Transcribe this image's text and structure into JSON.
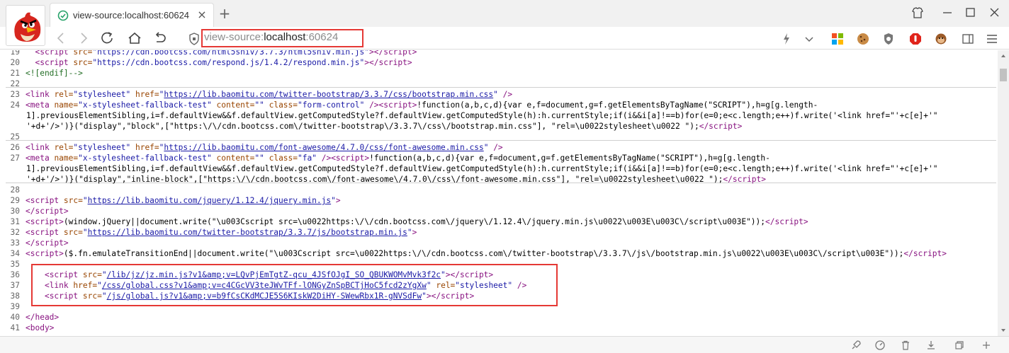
{
  "tab": {
    "title": "view-source:localhost:60624",
    "close": "×"
  },
  "new_tab": "+",
  "address": {
    "scheme": "view-source:",
    "host": "localhost",
    "port": ":60624"
  },
  "source_lines": [
    {
      "n": "19",
      "html": "  <span class=\"tag\">&lt;script</span> <span class=\"attr\">src=</span><span class=\"val\">\"https://cdn.bootcss.com/html5shiv/3.7.3/html5shiv.min.js\"</span><span class=\"tag\">&gt;&lt;/script&gt;</span>"
    },
    {
      "n": "20",
      "html": "  <span class=\"tag\">&lt;script</span> <span class=\"attr\">src=</span><span class=\"val\">\"https://cdn.bootcss.com/respond.js/1.4.2/respond.min.js\"</span><span class=\"tag\">&gt;&lt;/script&gt;</span>"
    },
    {
      "n": "21",
      "html": "<span class=\"cmt\">&lt;![endif]--&gt;</span>"
    },
    {
      "n": "22",
      "html": ""
    },
    {
      "n": "23",
      "html": "<span class=\"tag\">&lt;link</span> <span class=\"attr\">rel=</span><span class=\"val\">\"stylesheet\"</span> <span class=\"attr\">href=</span><span class=\"val\">\"</span><span class=\"link\">https://lib.baomitu.com/twitter-bootstrap/3.3.7/css/bootstrap.min.css</span><span class=\"val\">\"</span> <span class=\"tag\">/&gt;</span>"
    },
    {
      "n": "24",
      "html": "<span class=\"tag\">&lt;meta</span> <span class=\"attr\">name=</span><span class=\"val\">\"x-stylesheet-fallback-test\"</span> <span class=\"attr\">content=</span><span class=\"val\">\"\"</span> <span class=\"attr\">class=</span><span class=\"val\">\"form-control\"</span> <span class=\"tag\">/&gt;&lt;script&gt;</span>!function(a,b,c,d){var e,f=document,g=f.getElementsByTagName(\"SCRIPT\"),h=g[g.length-"
    },
    {
      "n": "",
      "html": "1].previousElementSibling,i=f.defaultView&amp;&amp;f.defaultView.getComputedStyle?f.defaultView.getComputedStyle(h):h.currentStyle;if(i&amp;&amp;i[a]!==b)for(e=0;e&lt;c.length;e++)f.write('&lt;link href=\"'+c[e]+'\""
    },
    {
      "n": "",
      "html": "'+d+'/&gt;')}(\"display\",\"block\",[\"https:\\/\\/cdn.bootcss.com\\/twitter-bootstrap\\/3.3.7\\/css\\/bootstrap.min.css\"], \"rel=\\u0022stylesheet\\u0022 \");<span class=\"tag\">&lt;/script&gt;</span>"
    },
    {
      "n": "25",
      "html": ""
    },
    {
      "n": "26",
      "html": "<span class=\"tag\">&lt;link</span> <span class=\"attr\">rel=</span><span class=\"val\">\"stylesheet\"</span> <span class=\"attr\">href=</span><span class=\"val\">\"</span><span class=\"link\">https://lib.baomitu.com/font-awesome/4.7.0/css/font-awesome.min.css</span><span class=\"val\">\"</span> <span class=\"tag\">/&gt;</span>"
    },
    {
      "n": "27",
      "html": "<span class=\"tag\">&lt;meta</span> <span class=\"attr\">name=</span><span class=\"val\">\"x-stylesheet-fallback-test\"</span> <span class=\"attr\">content=</span><span class=\"val\">\"\"</span> <span class=\"attr\">class=</span><span class=\"val\">\"fa\"</span> <span class=\"tag\">/&gt;&lt;script&gt;</span>!function(a,b,c,d){var e,f=document,g=f.getElementsByTagName(\"SCRIPT\"),h=g[g.length-"
    },
    {
      "n": "",
      "html": "1].previousElementSibling,i=f.defaultView&amp;&amp;f.defaultView.getComputedStyle?f.defaultView.getComputedStyle(h):h.currentStyle;if(i&amp;&amp;i[a]!==b)for(e=0;e&lt;c.length;e++)f.write('&lt;link href=\"'+c[e]+'\""
    },
    {
      "n": "",
      "html": "'+d+'/&gt;')}(\"display\",\"inline-block\",[\"https:\\/\\/cdn.bootcss.com\\/font-awesome\\/4.7.0\\/css\\/font-awesome.min.css\"], \"rel=\\u0022stylesheet\\u0022 \");<span class=\"tag\">&lt;/script&gt;</span>"
    },
    {
      "n": "28",
      "html": ""
    },
    {
      "n": "29",
      "html": "<span class=\"tag\">&lt;script</span> <span class=\"attr\">src=</span><span class=\"val\">\"</span><span class=\"link\">https://lib.baomitu.com/jquery/1.12.4/jquery.min.js</span><span class=\"val\">\"</span><span class=\"tag\">&gt;</span>"
    },
    {
      "n": "30",
      "html": "<span class=\"tag\">&lt;/script&gt;</span>"
    },
    {
      "n": "31",
      "html": "<span class=\"tag\">&lt;script&gt;</span>(window.jQuery||document.write(\"\\u003Cscript src=\\u0022https:\\/\\/cdn.bootcss.com\\/jquery\\/1.12.4\\/jquery.min.js\\u0022\\u003E\\u003C\\/script\\u003E\"));<span class=\"tag\">&lt;/script&gt;</span>"
    },
    {
      "n": "32",
      "html": "<span class=\"tag\">&lt;script</span> <span class=\"attr\">src=</span><span class=\"val\">\"</span><span class=\"link\">https://lib.baomitu.com/twitter-bootstrap/3.3.7/js/bootstrap.min.js</span><span class=\"val\">\"</span><span class=\"tag\">&gt;</span>"
    },
    {
      "n": "33",
      "html": "<span class=\"tag\">&lt;/script&gt;</span>"
    },
    {
      "n": "34",
      "html": "<span class=\"tag\">&lt;script&gt;</span>($.fn.emulateTransitionEnd||document.write(\"\\u003Cscript src=\\u0022https:\\/\\/cdn.bootcss.com\\/twitter-bootstrap\\/3.3.7\\/js\\/bootstrap.min.js\\u0022\\u003E\\u003C\\/script\\u003E\"));<span class=\"tag\">&lt;/script&gt;</span>"
    },
    {
      "n": "35",
      "html": ""
    },
    {
      "n": "36",
      "html": "    <span class=\"tag\">&lt;script</span> <span class=\"attr\">src=</span><span class=\"val\">\"</span><span class=\"link\">/lib/jz/jz.min.js?v1&amp;amp;v=LQvPjEmTgtZ-qcu_4JSfOJgI_SO_QBUKWOMvMvk3f2c</span><span class=\"val\">\"</span><span class=\"tag\">&gt;&lt;/script&gt;</span>"
    },
    {
      "n": "37",
      "html": "    <span class=\"tag\">&lt;link</span> <span class=\"attr\">href=</span><span class=\"val\">\"</span><span class=\"link\">/css/global.css?v1&amp;amp;v=c4CGcVV3teJWvTFf-lONGyZnSpBCTjHoC5fcd2zYgXw</span><span class=\"val\">\"</span> <span class=\"attr\">rel=</span><span class=\"val\">\"stylesheet\"</span> <span class=\"tag\">/&gt;</span>"
    },
    {
      "n": "38",
      "html": "    <span class=\"tag\">&lt;script</span> <span class=\"attr\">src=</span><span class=\"val\">\"</span><span class=\"link\">/js/global.js?v1&amp;amp;v=b9fCsCKdMCJE5S6KIskW2DiHY-SWewRbx1R-gNVSdFw</span><span class=\"val\">\"</span><span class=\"tag\">&gt;&lt;/script&gt;</span>"
    },
    {
      "n": "39",
      "html": ""
    },
    {
      "n": "40",
      "html": "<span class=\"tag\">&lt;/head&gt;</span>"
    },
    {
      "n": "41",
      "html": "<span class=\"tag\">&lt;body&gt;</span>"
    }
  ],
  "colors": {
    "highlight": "#e53935",
    "tag": "#881280",
    "attr": "#994500",
    "val": "#1a1aa6"
  }
}
